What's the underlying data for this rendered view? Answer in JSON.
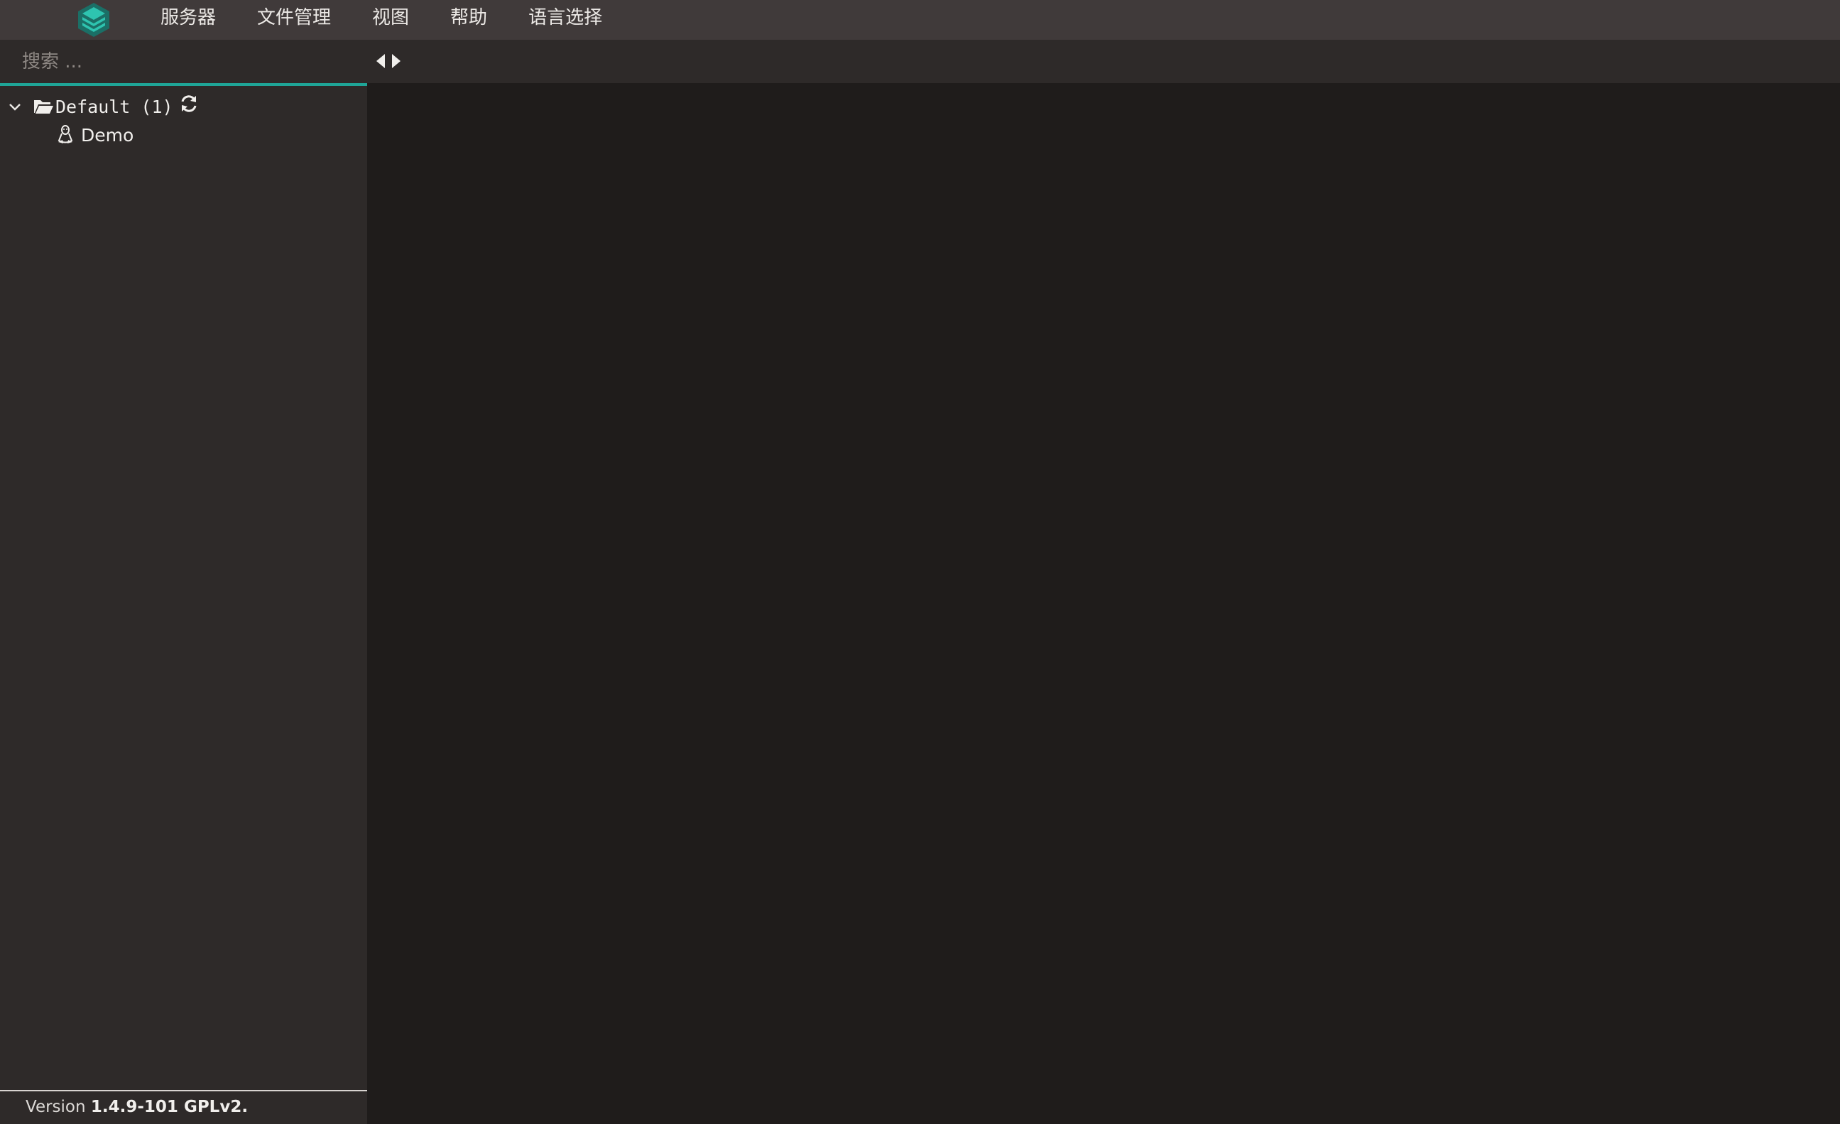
{
  "menu": {
    "items": [
      {
        "label": "服务器"
      },
      {
        "label": "文件管理"
      },
      {
        "label": "视图"
      },
      {
        "label": "帮助"
      },
      {
        "label": "语言选择"
      }
    ]
  },
  "sidebar": {
    "search_placeholder": "搜索 ...",
    "tree": {
      "group_label": "Default (1)",
      "hosts": [
        {
          "name": "Demo",
          "icon": "linux-icon"
        }
      ]
    },
    "footer": {
      "prefix": "Version ",
      "version": "1.4.9-101 GPLv2."
    }
  },
  "colors": {
    "menubar_bg": "#403a3a",
    "sidebar_bg": "#2e2a29",
    "main_bg": "#1f1c1b",
    "accent": "#1fa597"
  },
  "icons": {
    "logo": "app-logo-icon",
    "group": "folder-open-icon",
    "refresh": "refresh-icon",
    "collapse": "chevron-down-icon",
    "nav_prev": "caret-left-icon",
    "nav_next": "caret-right-icon"
  }
}
